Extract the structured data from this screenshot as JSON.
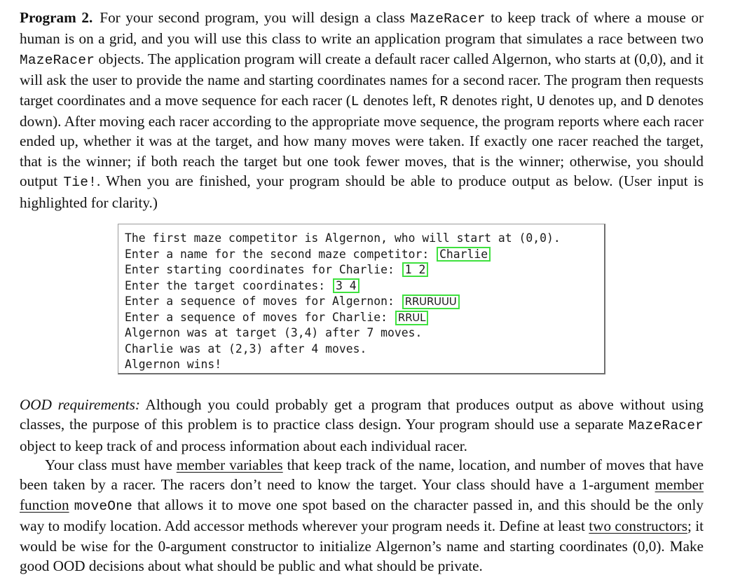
{
  "program_section": {
    "heading": "Program 2.",
    "segments": [
      {
        "t": "For your second program, you will design a class ",
        "s": "text"
      },
      {
        "t": "MazeRacer",
        "s": "code"
      },
      {
        "t": " to keep track of where a mouse or human is on a grid, and you will use this class to write an application program that simulates a race between two ",
        "s": "text"
      },
      {
        "t": "MazeRacer",
        "s": "code"
      },
      {
        "t": " objects. The application program will create a default racer called Algernon, who starts at (0,0), and it will ask the user to provide the name and starting coordinates names for a second racer. The program then requests target coordinates and a move sequence for each racer (",
        "s": "text"
      },
      {
        "t": "L",
        "s": "code"
      },
      {
        "t": " denotes left, ",
        "s": "text"
      },
      {
        "t": "R",
        "s": "code"
      },
      {
        "t": " denotes right, ",
        "s": "text"
      },
      {
        "t": "U",
        "s": "code"
      },
      {
        "t": " denotes up, and ",
        "s": "text"
      },
      {
        "t": "D",
        "s": "code"
      },
      {
        "t": " denotes down). After moving each racer according to the appropriate move sequence, the program reports where each racer ended up, whether it was at the target, and how many moves were taken. If exactly one racer reached the target, that is the winner; if both reach the target but one took fewer moves, that is the winner; otherwise, you should output ",
        "s": "text"
      },
      {
        "t": "Tie!",
        "s": "code"
      },
      {
        "t": ". When you are finished, your program should be able to produce output as below. (User input is highlighted for clarity.)",
        "s": "text"
      }
    ]
  },
  "terminal": {
    "lines": [
      {
        "prompt": "The first maze competitor is Algernon, who will start at (0,0).",
        "input": null,
        "input_font": null
      },
      {
        "prompt": "Enter a name for the second maze competitor: ",
        "input": "Charlie",
        "input_font": "mono"
      },
      {
        "prompt": "Enter starting coordinates for Charlie: ",
        "input": "1 2",
        "input_font": "mono"
      },
      {
        "prompt": "Enter the target coordinates: ",
        "input": "3 4",
        "input_font": "mono"
      },
      {
        "prompt": "Enter a sequence of moves for Algernon: ",
        "input": "RRURUUU",
        "input_font": "sans"
      },
      {
        "prompt": "Enter a sequence of moves for Charlie: ",
        "input": "RRUL",
        "input_font": "sans"
      },
      {
        "prompt": "Algernon was at target (3,4) after 7 moves.",
        "input": null,
        "input_font": null
      },
      {
        "prompt": "Charlie was at (2,3) after 4 moves.",
        "input": null,
        "input_font": null
      },
      {
        "prompt": "Algernon wins!",
        "input": null,
        "input_font": null
      }
    ],
    "highlight_color": "#3ee13e"
  },
  "ood_section": {
    "heading": "OOD requirements:",
    "segments": [
      {
        "t": "Although you could probably get a program that produces output as above without using classes, the purpose of this problem is to practice class design. Your program should use a separate ",
        "s": "text"
      },
      {
        "t": "MazeRacer",
        "s": "code"
      },
      {
        "t": " object to keep track of and process information about each individual racer.",
        "s": "text"
      }
    ]
  },
  "class_section": {
    "segments": [
      {
        "t": "Your class must have ",
        "s": "text"
      },
      {
        "t": "member variables",
        "s": "underline"
      },
      {
        "t": " that keep track of the name, location, and number of moves that have been taken by a racer. The racers don’t need to know the target. Your class should have a 1-argument ",
        "s": "text"
      },
      {
        "t": "member function",
        "s": "underline"
      },
      {
        "t": " ",
        "s": "text"
      },
      {
        "t": "moveOne",
        "s": "code"
      },
      {
        "t": " that allows it to move one spot based on the character passed in, and this should be the only way to modify location. Add accessor methods wherever your program needs it. Define at least ",
        "s": "text"
      },
      {
        "t": "two constructors",
        "s": "underline"
      },
      {
        "t": "; it would be wise for the 0-argument constructor to initialize Algernon’s name and starting coordinates (0,0). Make good OOD decisions about what should be public and what should be private.",
        "s": "text"
      }
    ]
  }
}
